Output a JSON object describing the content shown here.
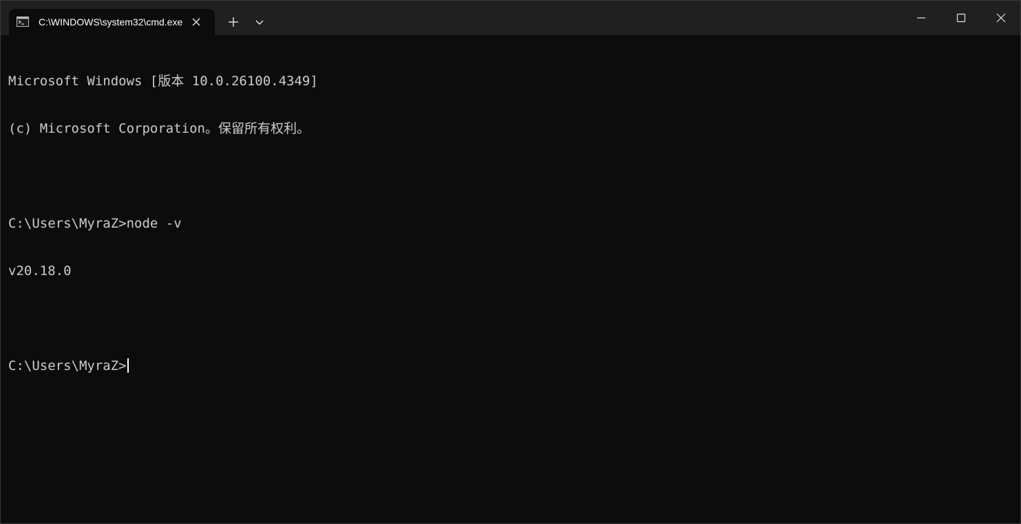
{
  "tab": {
    "title": "C:\\WINDOWS\\system32\\cmd.exe",
    "icon": "cmd-icon"
  },
  "titlebar": {
    "new_tab_icon": "plus-icon",
    "dropdown_icon": "chevron-down-icon",
    "minimize_icon": "minimize-icon",
    "maximize_icon": "maximize-icon",
    "close_icon": "close-icon"
  },
  "console": {
    "lines": [
      "Microsoft Windows [版本 10.0.26100.4349]",
      "(c) Microsoft Corporation。保留所有权利。",
      "",
      "C:\\Users\\MyraZ>node -v",
      "v20.18.0",
      ""
    ],
    "prompt": "C:\\Users\\MyraZ>"
  },
  "colors": {
    "background": "#0c0c0c",
    "titlebar": "#202020",
    "text": "#cccccc"
  }
}
